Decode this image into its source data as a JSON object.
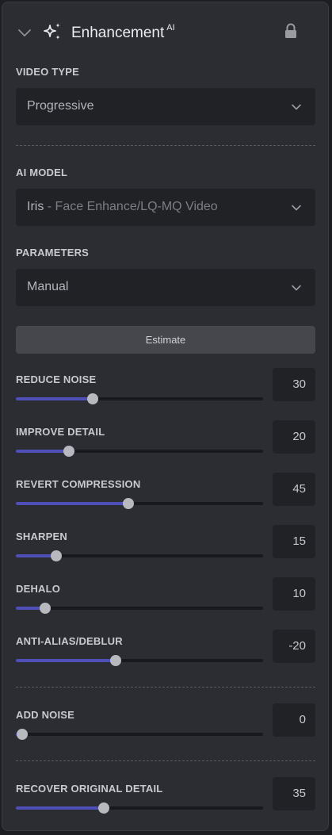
{
  "header": {
    "title": "Enhancement",
    "badge": "AI",
    "collapse_icon": "chevron-down-icon",
    "feature_icon": "sparkle-icon",
    "lock_icon": "lock-icon"
  },
  "video_type": {
    "label": "VIDEO TYPE",
    "value": "Progressive"
  },
  "ai_model": {
    "label": "AI MODEL",
    "value": "Iris",
    "sub": " - Face Enhance/LQ-MQ Video"
  },
  "parameters": {
    "label": "PARAMETERS",
    "value": "Manual"
  },
  "estimate_button": "Estimate",
  "sliders": [
    {
      "label": "REDUCE NOISE",
      "value": "30",
      "fill": 0.31
    },
    {
      "label": "IMPROVE DETAIL",
      "value": "20",
      "fill": 0.215
    },
    {
      "label": "REVERT COMPRESSION",
      "value": "45",
      "fill": 0.455
    },
    {
      "label": "SHARPEN",
      "value": "15",
      "fill": 0.165
    },
    {
      "label": "DEHALO",
      "value": "10",
      "fill": 0.12
    },
    {
      "label": "ANTI-ALIAS/DEBLUR",
      "value": "-20",
      "fill": 0.405
    },
    {
      "label": "ADD NOISE",
      "value": "0",
      "fill": 0.025
    },
    {
      "label": "RECOVER ORIGINAL DETAIL",
      "value": "35",
      "fill": 0.355
    }
  ],
  "colors": {
    "accent": "#4f4fb8",
    "panel": "#2c2d32",
    "field": "#212226"
  }
}
